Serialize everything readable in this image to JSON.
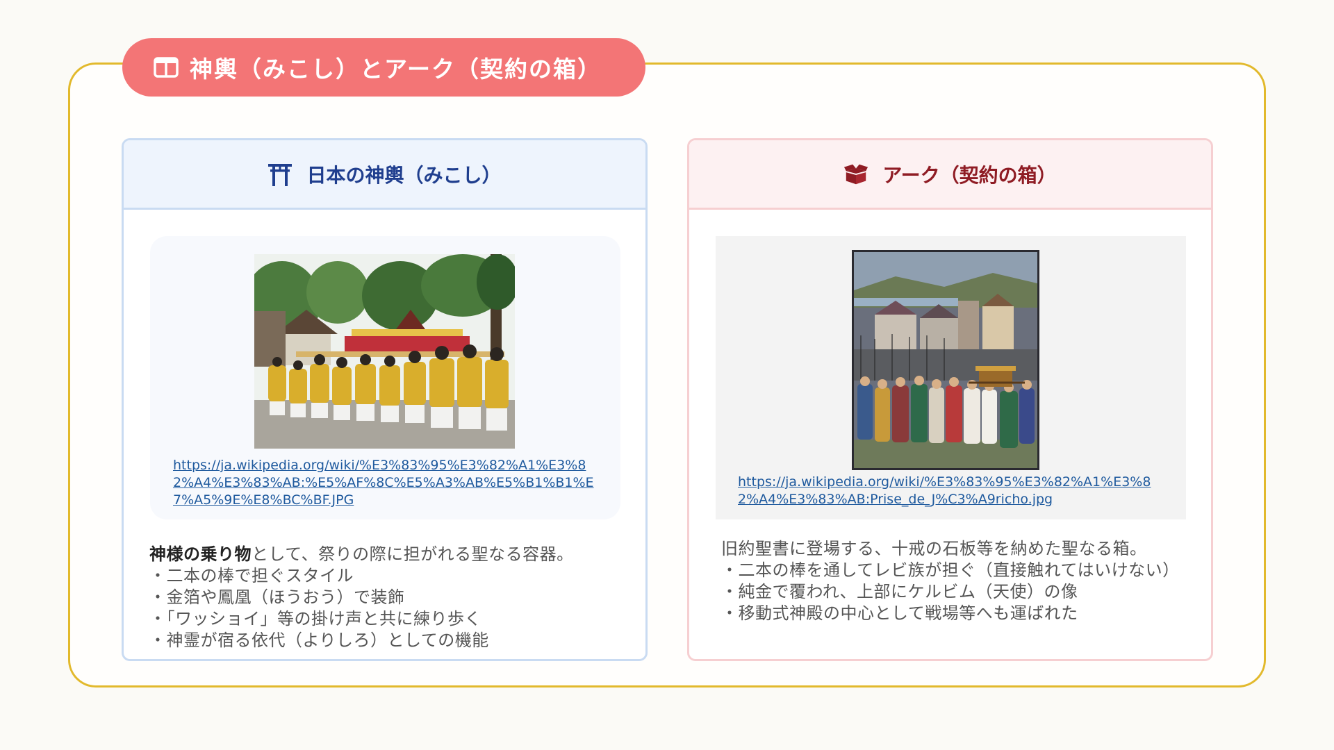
{
  "slide": {
    "title": "神輿（みこし）とアーク（契約の箱）",
    "title_icon": "book-open-icon",
    "colors": {
      "accent": "#f37576",
      "frame": "#e2b92c",
      "left_theme": "#1f3e8e",
      "right_theme": "#8f1c24"
    }
  },
  "mikoshi": {
    "heading": "日本の神輿（みこし）",
    "icon": "torii-gate-icon",
    "image_alt": "神輿",
    "source_url": "https://ja.wikipedia.org/wiki/%E3%83%95%E3%82%A1%E3%82%A4%E3%83%AB:%E5%AF%8C%E5%A3%AB%E5%B1%B1%E7%A5%9E%E8%BC%BF.JPG",
    "lead_bold": "神様の乗り物",
    "lead_rest": "として、祭りの際に担がれる聖なる容器。",
    "bullets": [
      "・二本の棒で担ぐスタイル",
      "・金箔や鳳凰（ほうおう）で装飾",
      "・「ワッショイ」等の掛け声と共に練り歩く",
      "・神霊が宿る依代（よりしろ）としての機能"
    ]
  },
  "ark": {
    "heading": "アーク（契約の箱）",
    "icon": "box-open-icon",
    "image_alt": "Prise de Jéricho",
    "source_url": "https://ja.wikipedia.org/wiki/%E3%83%95%E3%82%A1%E3%82%A4%E3%83%AB:Prise_de_J%C3%A9richo.jpg",
    "lead": "旧約聖書に登場する、十戒の石板等を納めた聖なる箱。",
    "bullets": [
      "・二本の棒を通してレビ族が担ぐ（直接触れてはいけない）",
      "・純金で覆われ、上部にケルビム（天使）の像",
      "・移動式神殿の中心として戦場等へも運ばれた"
    ]
  }
}
